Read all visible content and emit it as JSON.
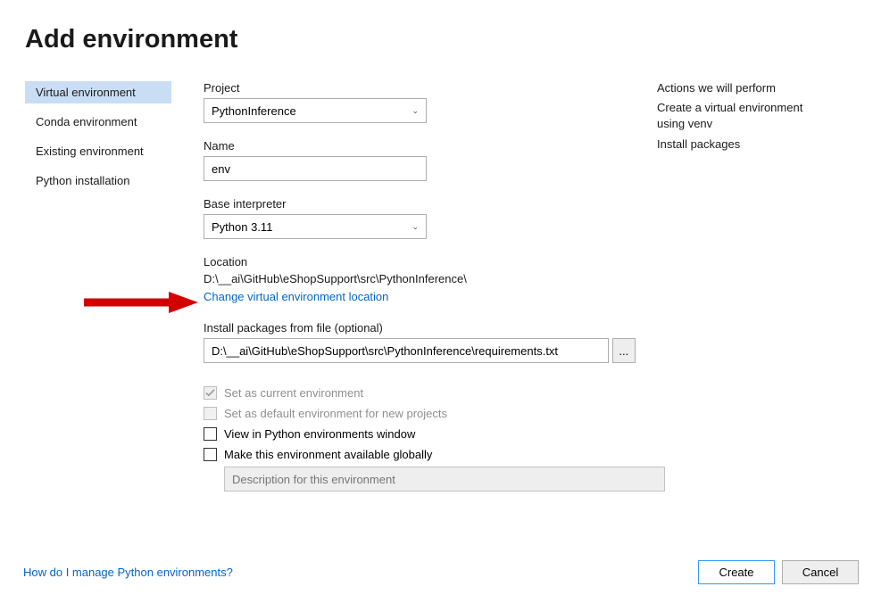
{
  "title": "Add environment",
  "sidebar": {
    "items": [
      {
        "label": "Virtual environment",
        "selected": true
      },
      {
        "label": "Conda environment",
        "selected": false
      },
      {
        "label": "Existing environment",
        "selected": false
      },
      {
        "label": "Python installation",
        "selected": false
      }
    ]
  },
  "form": {
    "project_label": "Project",
    "project_value": "PythonInference",
    "name_label": "Name",
    "name_value": "env",
    "base_interpreter_label": "Base interpreter",
    "base_interpreter_value": "Python 3.11",
    "location_label": "Location",
    "location_value": "D:\\__ai\\GitHub\\eShopSupport\\src\\PythonInference\\",
    "change_location_link": "Change virtual environment location",
    "install_packages_label": "Install packages from file (optional)",
    "install_packages_value": "D:\\__ai\\GitHub\\eShopSupport\\src\\PythonInference\\requirements.txt",
    "browse_label": "...",
    "checkboxes": {
      "set_current": {
        "label": "Set as current environment",
        "checked": true,
        "disabled": true
      },
      "set_default": {
        "label": "Set as default environment for new projects",
        "checked": false,
        "disabled": true
      },
      "view_in_env": {
        "label": "View in Python environments window",
        "checked": false,
        "disabled": false
      },
      "available_globally": {
        "label": "Make this environment available globally",
        "checked": false,
        "disabled": false
      }
    },
    "description_placeholder": "Description for this environment"
  },
  "actions_panel": {
    "heading": "Actions we will perform",
    "line1": "Create a virtual environment using venv",
    "line2": "Install packages"
  },
  "footer": {
    "help_link": "How do I manage Python environments?",
    "create_label": "Create",
    "cancel_label": "Cancel"
  }
}
